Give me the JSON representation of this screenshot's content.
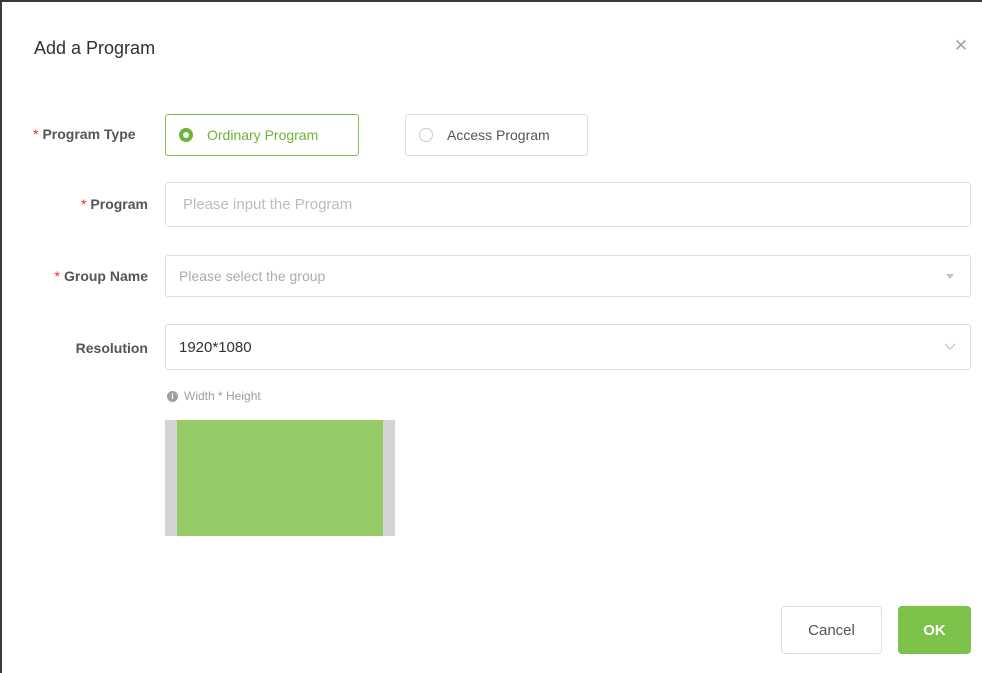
{
  "dialog": {
    "title": "Add a Program",
    "close_icon": "close-icon"
  },
  "program_type": {
    "label": "Program Type",
    "required_mark": "*",
    "options": [
      {
        "label": "Ordinary Program",
        "selected": true
      },
      {
        "label": "Access Program",
        "selected": false
      }
    ]
  },
  "program": {
    "label": "Program",
    "required_mark": "*",
    "value": "",
    "placeholder": "Please input the Program"
  },
  "group_name": {
    "label": "Group Name",
    "required_mark": "*",
    "value": "",
    "placeholder": "Please select the group"
  },
  "resolution": {
    "label": "Resolution",
    "value": "1920*1080",
    "hint": "Width * Height"
  },
  "footer": {
    "cancel_label": "Cancel",
    "ok_label": "OK"
  },
  "colors": {
    "accent": "#7cc24a",
    "preview_fill": "#95cb67",
    "preview_frame": "#d4d4d4",
    "required": "#f5222d"
  }
}
